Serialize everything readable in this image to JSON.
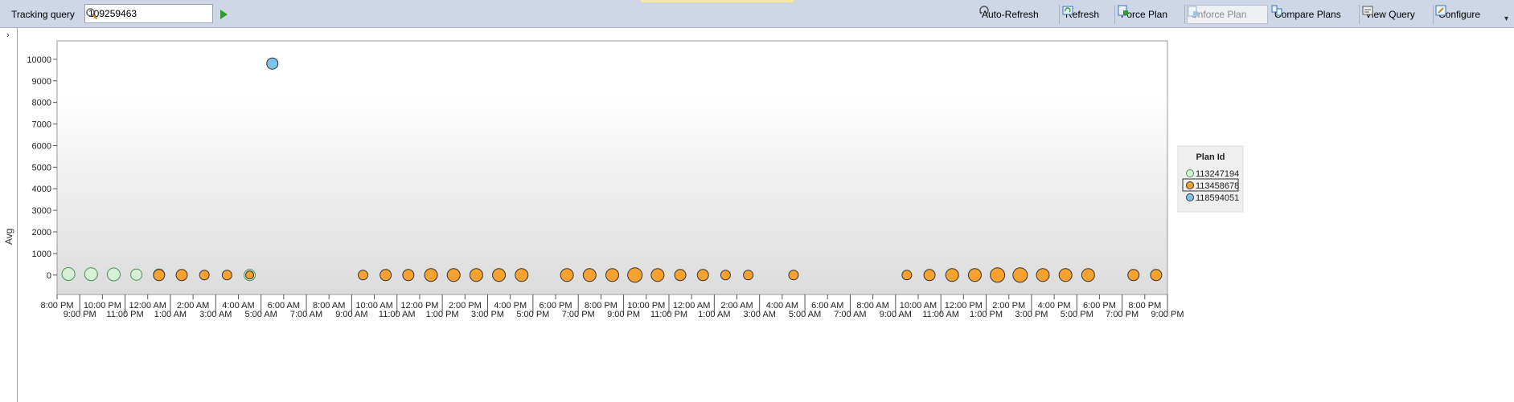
{
  "toolbar": {
    "tracking_label": "Tracking query",
    "query_value": "109259463",
    "buttons": [
      {
        "id": "auto-refresh",
        "label": "Auto-Refresh",
        "icon": "auto-refresh-icon",
        "enabled": true
      },
      {
        "id": "refresh",
        "label": "Refresh",
        "icon": "refresh-icon",
        "enabled": true
      },
      {
        "id": "force-plan",
        "label": "Force Plan",
        "icon": "force-plan-icon",
        "enabled": true
      },
      {
        "id": "unforce-plan",
        "label": "Unforce Plan",
        "icon": "unforce-plan-icon",
        "enabled": false
      },
      {
        "id": "compare-plans",
        "label": "Compare Plans",
        "icon": "compare-plans-icon",
        "enabled": true
      },
      {
        "id": "view-query",
        "label": "View Query",
        "icon": "view-query-icon",
        "enabled": true
      },
      {
        "id": "configure",
        "label": "Configure",
        "icon": "configure-icon",
        "enabled": true
      }
    ]
  },
  "side_panel": {
    "collapse_glyph": "›",
    "axis_label": "Avg"
  },
  "chart_data": {
    "type": "scatter",
    "ylabel": "Avg",
    "ylim": [
      -900,
      10850
    ],
    "yticks": [
      0,
      1000,
      2000,
      3000,
      4000,
      5000,
      6000,
      7000,
      8000,
      9000,
      10000
    ],
    "x_start_hours": 0,
    "x_end_hours": 49,
    "xticks_row1": [
      "8:00 PM",
      "10:00 PM",
      "12:00 AM",
      "2:00 AM",
      "4:00 AM",
      "6:00 AM",
      "8:00 AM",
      "10:00 AM",
      "12:00 PM",
      "2:00 PM",
      "4:00 PM",
      "6:00 PM",
      "8:00 PM",
      "10:00 PM",
      "12:00 AM",
      "2:00 AM",
      "4:00 AM",
      "6:00 AM",
      "8:00 AM",
      "10:00 AM",
      "12:00 PM",
      "2:00 PM",
      "4:00 PM",
      "6:00 PM",
      "8:00 PM"
    ],
    "xticks_row2": [
      "9:00 PM",
      "11:00 PM",
      "1:00 AM",
      "3:00 AM",
      "5:00 AM",
      "7:00 AM",
      "9:00 AM",
      "11:00 AM",
      "1:00 PM",
      "3:00 PM",
      "5:00 PM",
      "7:00 PM",
      "9:00 PM",
      "11:00 PM",
      "1:00 AM",
      "3:00 AM",
      "5:00 AM",
      "7:00 AM",
      "9:00 AM",
      "11:00 AM",
      "1:00 PM",
      "3:00 PM",
      "5:00 PM",
      "7:00 PM",
      "9:00 PM"
    ],
    "legend": {
      "title": "Plan Id",
      "position": "right"
    },
    "series": [
      {
        "name": "113247194",
        "color": "#d8f0d8",
        "stroke": "#4a8f5a",
        "points": [
          [
            0.5,
            50
          ],
          [
            1.5,
            40
          ],
          [
            2.5,
            30
          ],
          [
            3.5,
            20
          ],
          [
            4.5,
            20
          ],
          [
            8.5,
            0
          ]
        ],
        "sizes": [
          8,
          8,
          8,
          7,
          7,
          7
        ]
      },
      {
        "name": "113458678",
        "color": "#f7a131",
        "stroke": "#333333",
        "selected": true,
        "points": [
          [
            4.5,
            0
          ],
          [
            5.5,
            0
          ],
          [
            6.5,
            0
          ],
          [
            7.5,
            0
          ],
          [
            8.5,
            0
          ],
          [
            13.5,
            0
          ],
          [
            14.5,
            0
          ],
          [
            15.5,
            0
          ],
          [
            16.5,
            0
          ],
          [
            17.5,
            0
          ],
          [
            18.5,
            0
          ],
          [
            19.5,
            0
          ],
          [
            20.5,
            0
          ],
          [
            22.5,
            0
          ],
          [
            23.5,
            0
          ],
          [
            24.5,
            0
          ],
          [
            25.5,
            0
          ],
          [
            26.5,
            0
          ],
          [
            27.5,
            0
          ],
          [
            28.5,
            0
          ],
          [
            29.5,
            0
          ],
          [
            30.5,
            0
          ],
          [
            32.5,
            0
          ],
          [
            37.5,
            0
          ],
          [
            38.5,
            0
          ],
          [
            39.5,
            0
          ],
          [
            40.5,
            0
          ],
          [
            41.5,
            0
          ],
          [
            42.5,
            0
          ],
          [
            43.5,
            0
          ],
          [
            44.5,
            0
          ],
          [
            45.5,
            0
          ],
          [
            47.5,
            0
          ],
          [
            48.5,
            0
          ]
        ],
        "sizes": [
          7,
          7,
          6,
          6,
          5,
          6,
          7,
          7,
          8,
          8,
          8,
          8,
          8,
          8,
          8,
          8,
          9,
          8,
          7,
          7,
          6,
          6,
          6,
          6,
          7,
          8,
          8,
          9,
          9,
          8,
          8,
          8,
          7,
          7
        ]
      },
      {
        "name": "118594051",
        "color": "#7ec3ea",
        "stroke": "#333333",
        "points": [
          [
            9.5,
            9800
          ]
        ],
        "sizes": [
          7
        ]
      }
    ]
  }
}
